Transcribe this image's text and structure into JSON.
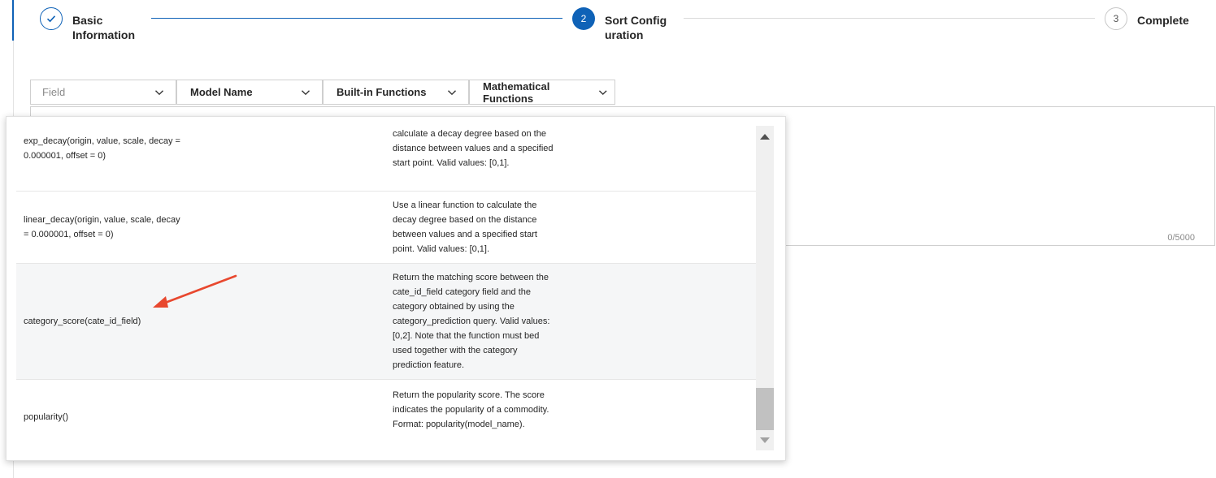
{
  "steps": [
    {
      "number": "",
      "label": "Basic Information",
      "state": "done",
      "icon": "check-icon"
    },
    {
      "number": "2",
      "label": "Sort Configuration",
      "state": "active"
    },
    {
      "number": "3",
      "label": "Complete",
      "state": "wait"
    }
  ],
  "selectors": [
    {
      "label": "Field",
      "is_placeholder": true
    },
    {
      "label": "Model Name",
      "is_placeholder": false
    },
    {
      "label": "Built-in Functions",
      "is_placeholder": false
    },
    {
      "label": "Mathematical Functions",
      "is_placeholder": false
    }
  ],
  "editor": {
    "counter": "0/5000"
  },
  "functions": [
    {
      "name": "exp_decay(origin, value, scale, decay = 0.000001, offset = 0)",
      "description": "calculate a decay degree based on the distance between values and a specified start point. Valid values: [0,1]."
    },
    {
      "name": "linear_decay(origin, value, scale, decay = 0.000001, offset = 0)",
      "description": "Use a linear function to calculate the decay degree based on the distance between values and a specified start point. Valid values: [0,1]."
    },
    {
      "name": "category_score(cate_id_field)",
      "description": "Return the matching score between the cate_id_field category field and the category obtained by using the category_prediction query. Valid values: [0,2]. Note that the function must bed used together with the category prediction feature.",
      "highlighted": true
    },
    {
      "name": "popularity()",
      "description": "Return the popularity score. The score indicates the popularity of a commodity. Format: popularity(model_name)."
    }
  ],
  "colors": {
    "primary": "#0f62b7",
    "annotation_arrow": "#e8482f"
  }
}
